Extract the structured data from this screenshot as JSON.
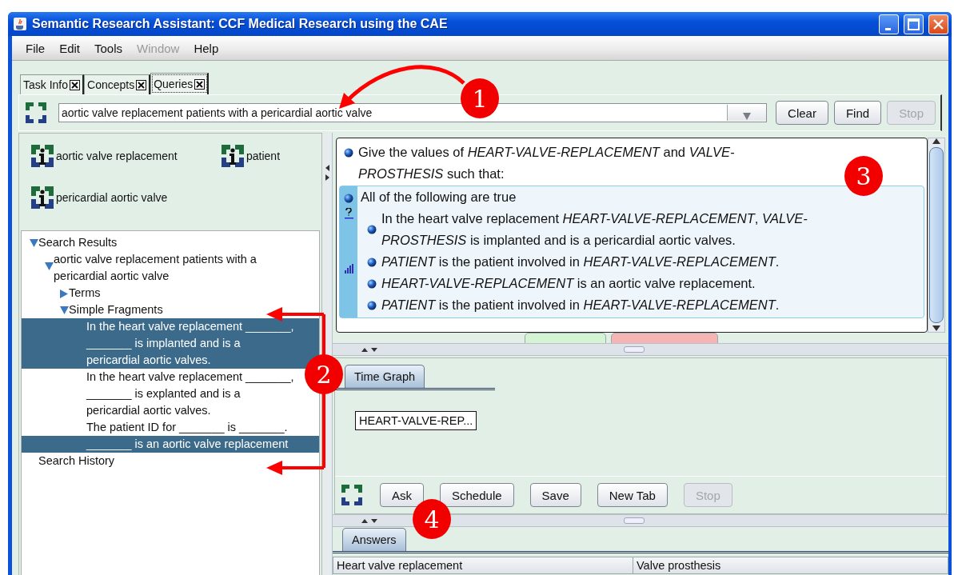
{
  "window": {
    "title": "Semantic Research Assistant: CCF Medical Research using the CAE"
  },
  "menu": [
    {
      "label": "File",
      "disabled": false
    },
    {
      "label": "Edit",
      "disabled": false
    },
    {
      "label": "Tools",
      "disabled": false
    },
    {
      "label": "Window",
      "disabled": true
    },
    {
      "label": "Help",
      "disabled": false
    }
  ],
  "tabs": [
    {
      "label": "Task Info",
      "selected": false
    },
    {
      "label": "Concepts",
      "selected": false
    },
    {
      "label": "Queries",
      "selected": true
    }
  ],
  "query": {
    "value": "aortic valve replacement  patients with a pericardial aortic valve",
    "buttons": [
      {
        "label": "Clear",
        "disabled": false
      },
      {
        "label": "Find",
        "disabled": false
      },
      {
        "label": "Stop",
        "disabled": true
      }
    ]
  },
  "concepts": [
    "aortic valve replacement",
    "patient",
    "pericardial aortic valve"
  ],
  "tree": [
    {
      "label": "Search Results",
      "expanded": true,
      "children": [
        {
          "label": "aortic valve replacement patients with a pericardial aortic valve",
          "expanded": true,
          "children": [
            {
              "label": "Terms",
              "expanded": false
            },
            {
              "label": "Simple Fragments",
              "expanded": true,
              "children": [
                {
                  "label": "In the heart valve replacement _______, _______ is implanted and is a pericardial aortic valves.",
                  "selected": true
                },
                {
                  "label": "In the heart valve replacement _______, _______ is explanted and is a pericardial aortic valves.",
                  "selected": false
                },
                {
                  "label": "The patient ID for _______ is _______.",
                  "selected": false
                },
                {
                  "label": "_______ is an aortic valve replacement",
                  "selected": true
                }
              ]
            }
          ]
        }
      ]
    },
    {
      "label": "Search History"
    }
  ],
  "question": {
    "intro": "Give the values of *HEART-VALVE-REPLACEMENT* and *VALVE-PROSTHESIS* such that:",
    "group_title": "All of the following are true",
    "conditions": [
      "In the heart valve replacement *HEART-VALVE-REPLACEMENT*, *VALVE-PROSTHESIS* is implanted and is a pericardial aortic valves.",
      "*PATIENT* is the patient involved in *HEART-VALVE-REPLACEMENT*.",
      "*HEART-VALVE-REPLACEMENT* is an aortic valve replacement.",
      "*PATIENT* is the patient involved in *HEART-VALVE-REPLACEMENT*."
    ]
  },
  "time_graph": {
    "tab": {
      "label": "Time Graph",
      "selected": true
    },
    "nodes": [
      "HEART-VALVE-REP..."
    ]
  },
  "actions": [
    {
      "label": "Ask",
      "disabled": false
    },
    {
      "label": "Schedule",
      "disabled": false
    },
    {
      "label": "Save",
      "disabled": false
    },
    {
      "label": "New Tab",
      "disabled": false
    },
    {
      "label": "Stop",
      "disabled": true
    }
  ],
  "answers": {
    "tab": {
      "label": "Answers",
      "selected": true
    },
    "columns": [
      "Heart valve replacement",
      "Valve prosthesis"
    ]
  },
  "callouts": [
    "1",
    "2",
    "3",
    "4"
  ]
}
